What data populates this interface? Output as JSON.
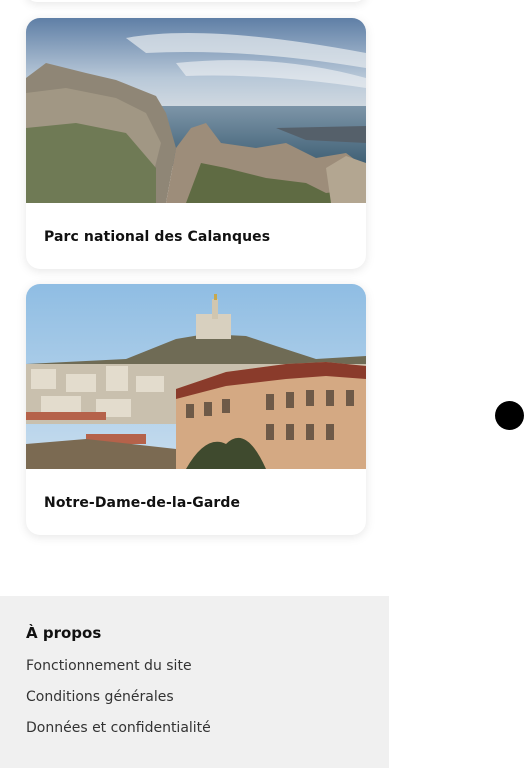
{
  "cards": [
    {
      "title": "Parc national des Calanques",
      "image": "coastal-cliffs-photo"
    },
    {
      "title": "Notre-Dame-de-la-Garde",
      "image": "marseille-basilica-photo"
    }
  ],
  "footer": {
    "heading": "À propos",
    "links": [
      "Fonctionnement du site",
      "Conditions générales",
      "Données et confidentialité"
    ]
  }
}
